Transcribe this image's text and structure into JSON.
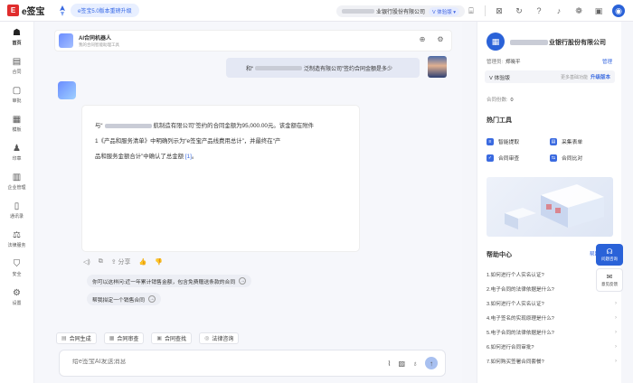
{
  "app": {
    "logo_mark": "E",
    "logo_text": "e签宝"
  },
  "banner": {
    "text": "e签宝5.0版本重磅升级"
  },
  "company_selector": {
    "name": "业银行股份有限公司",
    "badge": "V 体验版 ▾"
  },
  "top_icons": [
    "org-icon",
    "inbox-icon",
    "history-icon",
    "help-icon",
    "bell-icon",
    "apps-icon",
    "window-icon",
    "user-icon"
  ],
  "nav": [
    {
      "label": "首页",
      "icon": "☗"
    },
    {
      "label": "合同",
      "icon": "▤"
    },
    {
      "label": "审批",
      "icon": "▢"
    },
    {
      "label": "模板",
      "icon": "▦"
    },
    {
      "label": "印章",
      "icon": "♟"
    },
    {
      "label": "企业管理",
      "icon": "▥"
    },
    {
      "label": "通讯录",
      "icon": "▯"
    },
    {
      "label": "法律服务",
      "icon": "⚖"
    },
    {
      "label": "安全",
      "icon": "⛉"
    },
    {
      "label": "设置",
      "icon": "⚙"
    }
  ],
  "chat": {
    "bot_name": "AI合同机器人",
    "bot_desc": "我的合同智能助理工具",
    "user_msg_pre": "和“",
    "user_msg_post": "泛制造有限公司”签约合同金额是多少",
    "ai_line1_pre": "与“",
    "ai_line1_post": "航制造有限公司”签约的合同金额为95,000.00元。该金额在附件",
    "ai_line2": "1《产品和服务清单》中明确列示为“e签宝产品线费用总计”，并最终在“产",
    "ai_line3_pre": "品和服务金额合计”中确认了总金额 ",
    "ai_ref": "[1]",
    "ai_line3_post": "。",
    "ai_tools": [
      "◁)",
      "⧉",
      "⇪ 分享",
      "👍",
      "👎"
    ],
    "suggestions": [
      "你可以这样问:近一年累计销售金额，包含免费赠送条款的合同",
      "帮我拟定一个销售合同"
    ],
    "quick_actions": [
      {
        "icon": "▤",
        "label": "合同生成"
      },
      {
        "icon": "▦",
        "label": "合同审查"
      },
      {
        "icon": "▣",
        "label": "合同查找"
      },
      {
        "icon": "◎",
        "label": "法律咨询"
      }
    ],
    "input_placeholder": "给e签宝AI发送消息"
  },
  "right_panel": {
    "company": "业银行股份有限公司",
    "admin_label": "管理员:",
    "admin_name": "郑晓平",
    "manage": "管理",
    "plan": "V 体验版",
    "plan_more": "更多基础功能",
    "upgrade": "升级版本",
    "contract_count_label": "合同份数:",
    "contract_count": "0",
    "tools_title": "热门工具",
    "tools": [
      "智能提取",
      "采集表单",
      "合同审查",
      "合同比对"
    ],
    "help_title": "帮助中心",
    "help_link": "帮助",
    "help_items": [
      "1.如何进行个人实名认证?",
      "2.电子合同的法律依据是什么?",
      "3.如何进行个人实名认证?",
      "4.电子签名的实现原理是什么?",
      "5.电子合同的法律依据是什么?",
      "6.如何进行合同审批?",
      "7.如何购买签署合同套餐?"
    ]
  },
  "float_buttons": {
    "help": "问题咨询",
    "feedback": "意见反馈"
  }
}
